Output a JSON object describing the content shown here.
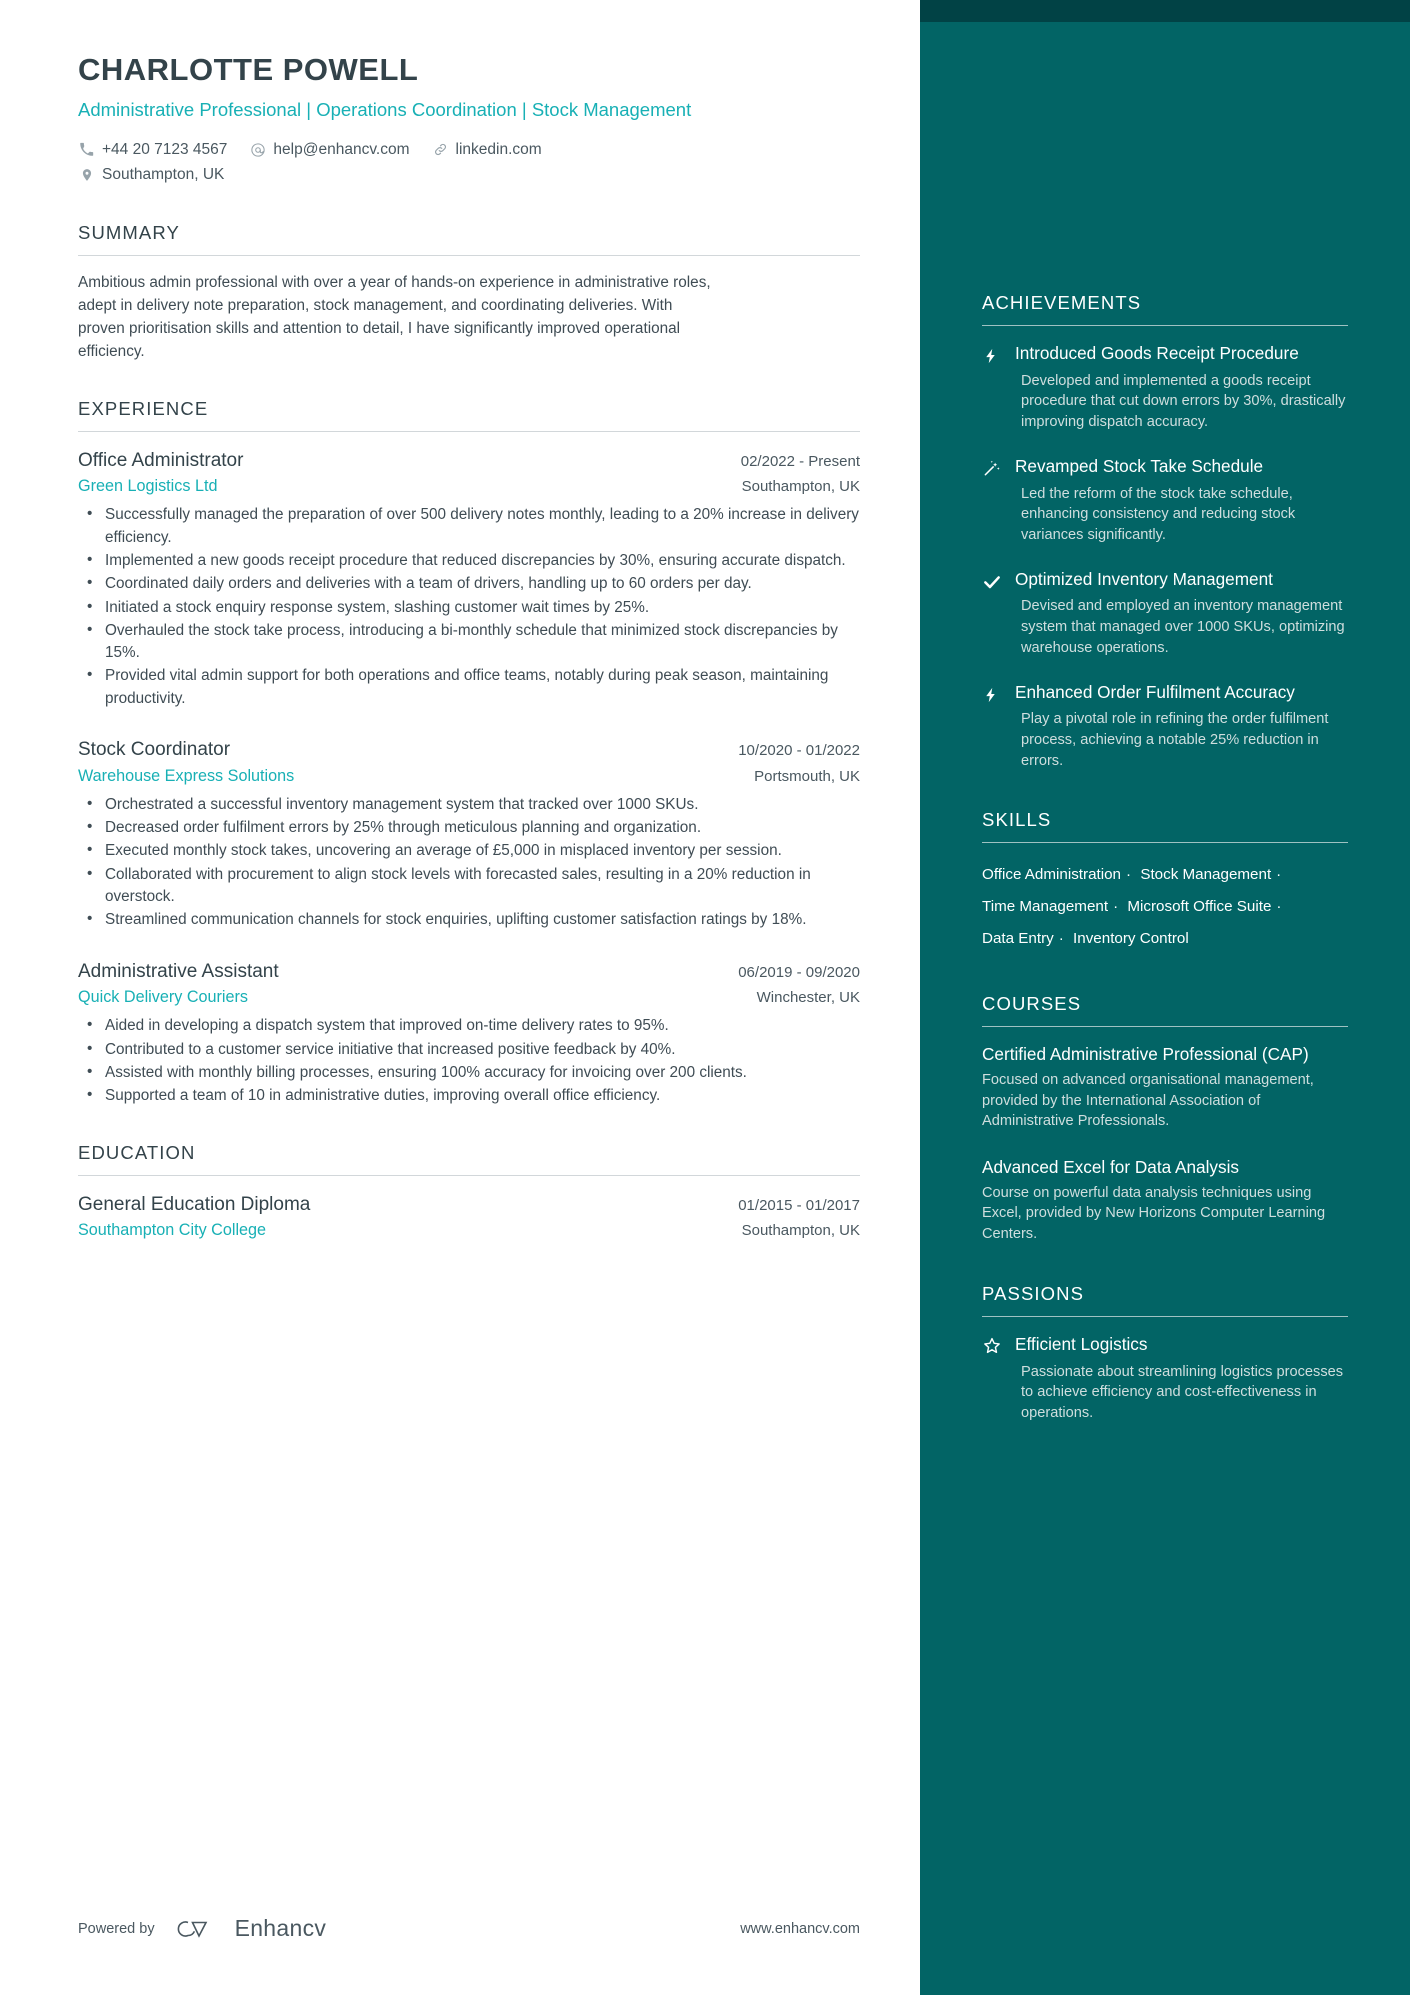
{
  "header": {
    "name": "CHARLOTTE POWELL",
    "headline": "Administrative Professional | Operations Coordination | Stock Management",
    "contacts": [
      {
        "icon": "phone-icon",
        "text": "+44 20 7123 4567"
      },
      {
        "icon": "email-icon",
        "text": "help@enhancv.com"
      },
      {
        "icon": "link-icon",
        "text": "linkedin.com"
      }
    ],
    "location": {
      "icon": "location-pin-icon",
      "text": "Southampton, UK"
    }
  },
  "summary": {
    "title": "SUMMARY",
    "text": "Ambitious admin professional with over a year of hands-on experience in administrative roles, adept in delivery note preparation, stock management, and coordinating deliveries. With proven prioritisation skills and attention to detail, I have significantly improved operational efficiency."
  },
  "experience": {
    "title": "EXPERIENCE",
    "entries": [
      {
        "role": "Office Administrator",
        "dates": "02/2022 - Present",
        "company": "Green Logistics Ltd",
        "location": "Southampton, UK",
        "bullets": [
          "Successfully managed the preparation of over 500 delivery notes monthly, leading to a 20% increase in delivery efficiency.",
          "Implemented a new goods receipt procedure that reduced discrepancies by 30%, ensuring accurate dispatch.",
          "Coordinated daily orders and deliveries with a team of drivers, handling up to 60 orders per day.",
          "Initiated a stock enquiry response system, slashing customer wait times by 25%.",
          "Overhauled the stock take process, introducing a bi-monthly schedule that minimized stock discrepancies by 15%.",
          "Provided vital admin support for both operations and office teams, notably during peak season, maintaining productivity."
        ]
      },
      {
        "role": "Stock Coordinator",
        "dates": "10/2020 - 01/2022",
        "company": "Warehouse Express Solutions",
        "location": "Portsmouth, UK",
        "bullets": [
          "Orchestrated a successful inventory management system that tracked over 1000 SKUs.",
          "Decreased order fulfilment errors by 25% through meticulous planning and organization.",
          "Executed monthly stock takes, uncovering an average of £5,000 in misplaced inventory per session.",
          "Collaborated with procurement to align stock levels with forecasted sales, resulting in a 20% reduction in overstock.",
          "Streamlined communication channels for stock enquiries, uplifting customer satisfaction ratings by 18%."
        ]
      },
      {
        "role": "Administrative Assistant",
        "dates": "06/2019 - 09/2020",
        "company": "Quick Delivery Couriers",
        "location": "Winchester, UK",
        "bullets": [
          "Aided in developing a dispatch system that improved on-time delivery rates to 95%.",
          "Contributed to a customer service initiative that increased positive feedback by 40%.",
          "Assisted with monthly billing processes, ensuring 100% accuracy for invoicing over 200 clients.",
          "Supported a team of 10 in administrative duties, improving overall office efficiency."
        ]
      }
    ]
  },
  "education": {
    "title": "EDUCATION",
    "entries": [
      {
        "degree": "General Education Diploma",
        "dates": "01/2015 - 01/2017",
        "school": "Southampton City College",
        "location": "Southampton, UK"
      }
    ]
  },
  "achievements": {
    "title": "ACHIEVEMENTS",
    "items": [
      {
        "icon": "bolt-icon",
        "title": "Introduced Goods Receipt Procedure",
        "desc": "Developed and implemented a goods receipt procedure that cut down errors by 30%, drastically improving dispatch accuracy."
      },
      {
        "icon": "magic-wand-icon",
        "title": "Revamped Stock Take Schedule",
        "desc": "Led the reform of the stock take schedule, enhancing consistency and reducing stock variances significantly."
      },
      {
        "icon": "check-icon",
        "title": "Optimized Inventory Management",
        "desc": "Devised and employed an inventory management system that managed over 1000 SKUs, optimizing warehouse operations."
      },
      {
        "icon": "bolt-icon",
        "title": "Enhanced Order Fulfilment Accuracy",
        "desc": "Play a pivotal role in refining the order fulfilment process, achieving a notable 25% reduction in errors."
      }
    ]
  },
  "skills": {
    "title": "SKILLS",
    "items": [
      "Office Administration",
      "Stock Management",
      "Time Management",
      "Microsoft Office Suite",
      "Data Entry",
      "Inventory Control"
    ],
    "separator": "·"
  },
  "courses": {
    "title": "COURSES",
    "items": [
      {
        "title": "Certified Administrative Professional (CAP)",
        "desc": "Focused on advanced organisational management, provided by the International Association of Administrative Professionals."
      },
      {
        "title": "Advanced Excel for Data Analysis",
        "desc": "Course on powerful data analysis techniques using Excel, provided by New Horizons Computer Learning Centers."
      }
    ]
  },
  "passions": {
    "title": "PASSIONS",
    "items": [
      {
        "icon": "star-outline-icon",
        "title": "Efficient Logistics",
        "desc": "Passionate about streamlining logistics processes to achieve efficiency and cost-effectiveness in operations."
      }
    ]
  },
  "footer": {
    "powered_by": "Powered by",
    "brand": "Enhancv",
    "website": "www.enhancv.com"
  },
  "colors": {
    "accent_teal": "#18b0b5",
    "sidebar_bg": "#026465",
    "sidebar_band": "#014245",
    "heading": "#33434a"
  }
}
